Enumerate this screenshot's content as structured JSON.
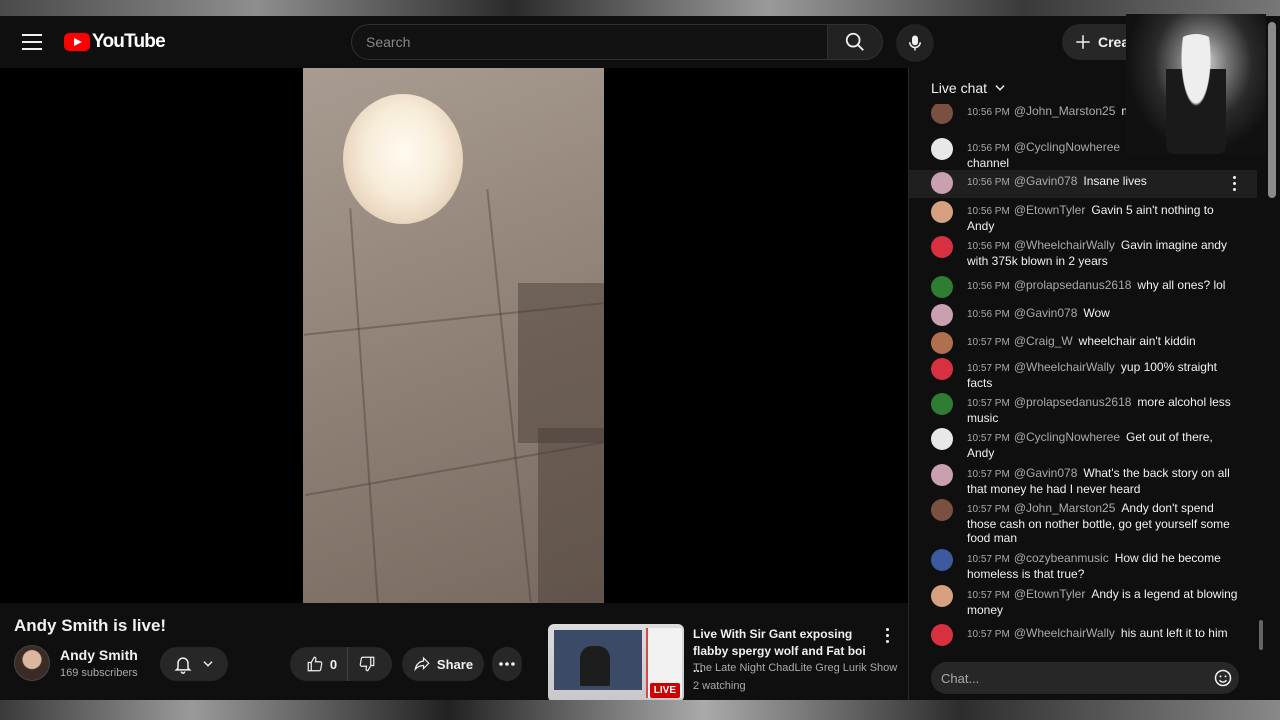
{
  "masthead": {
    "logo_text": "YouTube",
    "search_placeholder": "Search",
    "create_label": "Create"
  },
  "video": {
    "title": "Andy Smith is live!",
    "channel_name": "Andy Smith",
    "subscribers": "169 subscribers",
    "like_count": "0",
    "share_label": "Share"
  },
  "recommended": {
    "title": "Live With Sir Gant exposing flabby spergy wolf and Fat boi ...",
    "channel": "The Late Night ChadLite Greg Lurik Show",
    "watching": "2 watching",
    "badge": "LIVE"
  },
  "chat": {
    "header": "Live chat",
    "input_placeholder": "Chat...",
    "messages": [
      {
        "time": "10:56 PM",
        "author": "@John_Marston25",
        "text": "man needs help",
        "color": "#7a5040"
      },
      {
        "time": "10:56 PM",
        "author": "@CyclingNowheree",
        "text": "another youtube channel",
        "color": "#e8e8e8"
      },
      {
        "time": "10:56 PM",
        "author": "@Gavin078",
        "text": "Insane lives",
        "color": "#c8a0b0"
      },
      {
        "time": "10:56 PM",
        "author": "@EtownTyler",
        "text": "Gavin 5 ain't nothing to Andy",
        "color": "#d7a080"
      },
      {
        "time": "10:56 PM",
        "author": "@WheelchairWally",
        "text": "Gavin imagine andy with 375k blown in 2 years",
        "color": "#d83040"
      },
      {
        "time": "10:56 PM",
        "author": "@prolapsedanus2618",
        "text": "why all ones? lol",
        "color": "#2e7d32"
      },
      {
        "time": "10:56 PM",
        "author": "@Gavin078",
        "text": "Wow",
        "color": "#c8a0b0"
      },
      {
        "time": "10:57 PM",
        "author": "@Craig_W",
        "text": "wheelchair ain't kiddin",
        "color": "#b07050"
      },
      {
        "time": "10:57 PM",
        "author": "@WheelchairWally",
        "text": "yup 100% straight facts",
        "color": "#d83040"
      },
      {
        "time": "10:57 PM",
        "author": "@prolapsedanus2618",
        "text": "more alcohol less music",
        "color": "#2e7d32"
      },
      {
        "time": "10:57 PM",
        "author": "@CyclingNowheree",
        "text": "Get out of there, Andy",
        "color": "#e8e8e8"
      },
      {
        "time": "10:57 PM",
        "author": "@Gavin078",
        "text": "What's the back story on all that money he had I never heard",
        "color": "#c8a0b0"
      },
      {
        "time": "10:57 PM",
        "author": "@John_Marston25",
        "text": "Andy don't spend those cash on nother bottle, go get yourself some food man",
        "color": "#7a5040"
      },
      {
        "time": "10:57 PM",
        "author": "@cozybeanmusic",
        "text": "How did he become homeless is that true?",
        "color": "#3d5a9e"
      },
      {
        "time": "10:57 PM",
        "author": "@EtownTyler",
        "text": "Andy is a legend at blowing money",
        "color": "#d7a080"
      },
      {
        "time": "10:57 PM",
        "author": "@WheelchairWally",
        "text": "his aunt left it to him",
        "color": "#d83040"
      }
    ]
  }
}
